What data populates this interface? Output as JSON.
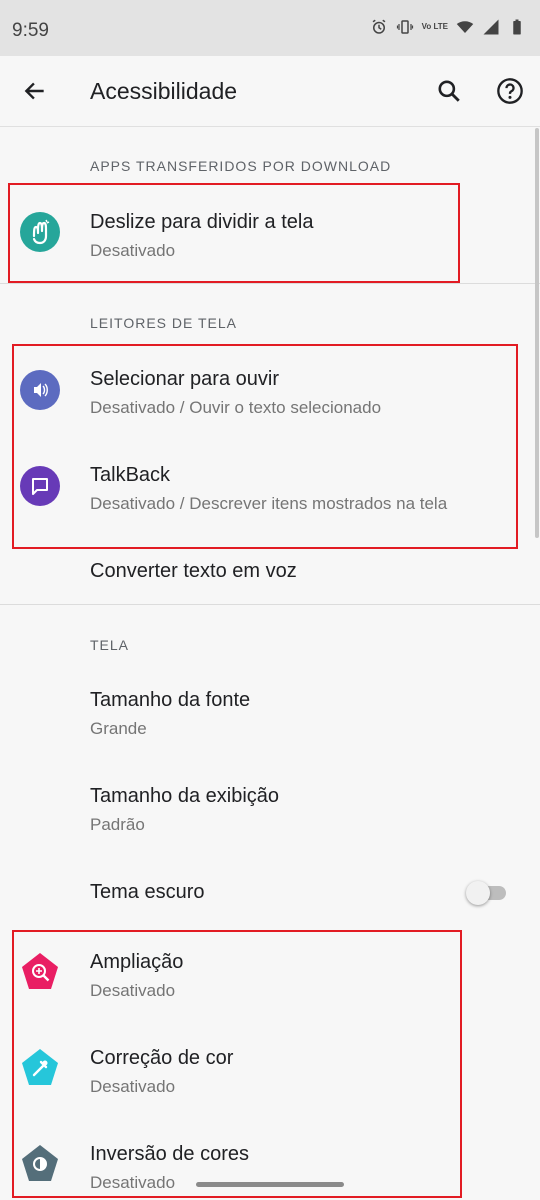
{
  "status_bar": {
    "time": "9:59",
    "lte_label": "Vo LTE"
  },
  "app_bar": {
    "title": "Acessibilidade"
  },
  "sections": {
    "downloaded": {
      "header": "APPS TRANSFERIDOS POR DOWNLOAD",
      "items": [
        {
          "title": "Deslize para dividir a tela",
          "subtitle": "Desativado"
        }
      ]
    },
    "screen_readers": {
      "header": "LEITORES DE TELA",
      "items": [
        {
          "title": "Selecionar para ouvir",
          "subtitle": "Desativado / Ouvir o texto selecionado"
        },
        {
          "title": "TalkBack",
          "subtitle": "Desativado / Descrever itens mostrados na tela"
        },
        {
          "title": "Converter texto em voz"
        }
      ]
    },
    "display": {
      "header": "TELA",
      "items": [
        {
          "title": "Tamanho da fonte",
          "subtitle": "Grande"
        },
        {
          "title": "Tamanho da exibição",
          "subtitle": "Padrão"
        },
        {
          "title": "Tema escuro",
          "toggle_on": false
        },
        {
          "title": "Ampliação",
          "subtitle": "Desativado"
        },
        {
          "title": "Correção de cor",
          "subtitle": "Desativado"
        },
        {
          "title": "Inversão de cores",
          "subtitle": "Desativado"
        }
      ]
    }
  },
  "colors": {
    "highlight": "#e21b23",
    "swipe_icon": "#26a69a",
    "select_to_speak_icon": "#5c6bc0",
    "talkback_icon": "#673ab7",
    "magnification_icon": "#e91e63",
    "color_correction_icon": "#26c6da",
    "color_inversion_icon": "#546e7a"
  },
  "icons": {
    "back": "arrow-back-icon",
    "search": "search-icon",
    "help": "help-icon",
    "swipe": "swipe-hand-icon",
    "select_to_speak": "select-to-speak-icon",
    "talkback": "talkback-icon",
    "magnification": "magnification-icon",
    "color_correction": "eyedropper-icon",
    "color_inversion": "invert-colors-icon"
  }
}
